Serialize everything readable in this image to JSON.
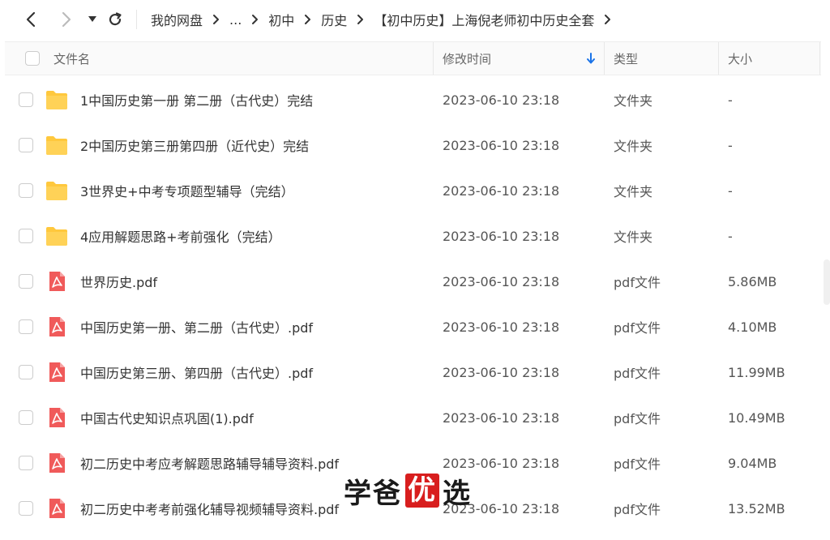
{
  "toolbar": {
    "breadcrumb": [
      "我的网盘",
      "...",
      "初中",
      "历史",
      "【初中历史】上海倪老师初中历史全套"
    ]
  },
  "columns": {
    "name": "文件名",
    "modified": "修改时间",
    "type": "类型",
    "size": "大小"
  },
  "files": [
    {
      "name": "1中国历史第一册 第二册（古代史）完结",
      "modified": "2023-06-10 23:18",
      "type": "文件夹",
      "size": "-",
      "icon": "folder-icon"
    },
    {
      "name": "2中国历史第三册第四册（近代史）完结",
      "modified": "2023-06-10 23:18",
      "type": "文件夹",
      "size": "-",
      "icon": "folder-icon"
    },
    {
      "name": "3世界史+中考专项题型辅导（完结）",
      "modified": "2023-06-10 23:18",
      "type": "文件夹",
      "size": "-",
      "icon": "folder-icon"
    },
    {
      "name": "4应用解题思路+考前强化（完结）",
      "modified": "2023-06-10 23:18",
      "type": "文件夹",
      "size": "-",
      "icon": "folder-icon"
    },
    {
      "name": "世界历史.pdf",
      "modified": "2023-06-10 23:18",
      "type": "pdf文件",
      "size": "5.86MB",
      "icon": "pdf-icon"
    },
    {
      "name": "中国历史第一册、第二册（古代史）.pdf",
      "modified": "2023-06-10 23:18",
      "type": "pdf文件",
      "size": "4.10MB",
      "icon": "pdf-icon"
    },
    {
      "name": "中国历史第三册、第四册（古代史）.pdf",
      "modified": "2023-06-10 23:18",
      "type": "pdf文件",
      "size": "11.99MB",
      "icon": "pdf-icon"
    },
    {
      "name": "中国古代史知识点巩固(1).pdf",
      "modified": "2023-06-10 23:18",
      "type": "pdf文件",
      "size": "10.49MB",
      "icon": "pdf-icon"
    },
    {
      "name": "初二历史中考应考解题思路辅导辅导资料.pdf",
      "modified": "2023-06-10 23:18",
      "type": "pdf文件",
      "size": "9.04MB",
      "icon": "pdf-icon"
    },
    {
      "name": "初二历史中考考前强化辅导视频辅导资料.pdf",
      "modified": "2023-06-10 23:18",
      "type": "pdf文件",
      "size": "13.52MB",
      "icon": "pdf-icon"
    }
  ],
  "watermark": {
    "part1": "学爸",
    "part2": "优",
    "part3": "选"
  },
  "colors": {
    "folder": "#FFC83D",
    "pdf": "#F05A5A",
    "sort_arrow": "#1A73E8",
    "watermark_red": "#D81E1E"
  }
}
